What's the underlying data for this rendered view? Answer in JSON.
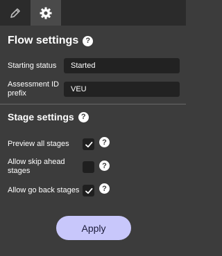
{
  "tabs": [
    {
      "icon": "pencil-icon",
      "active": false
    },
    {
      "icon": "gear-icon",
      "active": true
    }
  ],
  "flow": {
    "title": "Flow settings",
    "fields": [
      {
        "label": "Starting status",
        "value": "Started"
      },
      {
        "label": "Assessment ID prefix",
        "value": "VEU"
      }
    ]
  },
  "stage": {
    "title": "Stage settings",
    "options": [
      {
        "label": "Preview all stages",
        "checked": true
      },
      {
        "label": "Allow skip ahead stages",
        "checked": false
      },
      {
        "label": "Allow go back stages",
        "checked": true
      }
    ]
  },
  "help_glyph": "?",
  "apply_label": "Apply"
}
